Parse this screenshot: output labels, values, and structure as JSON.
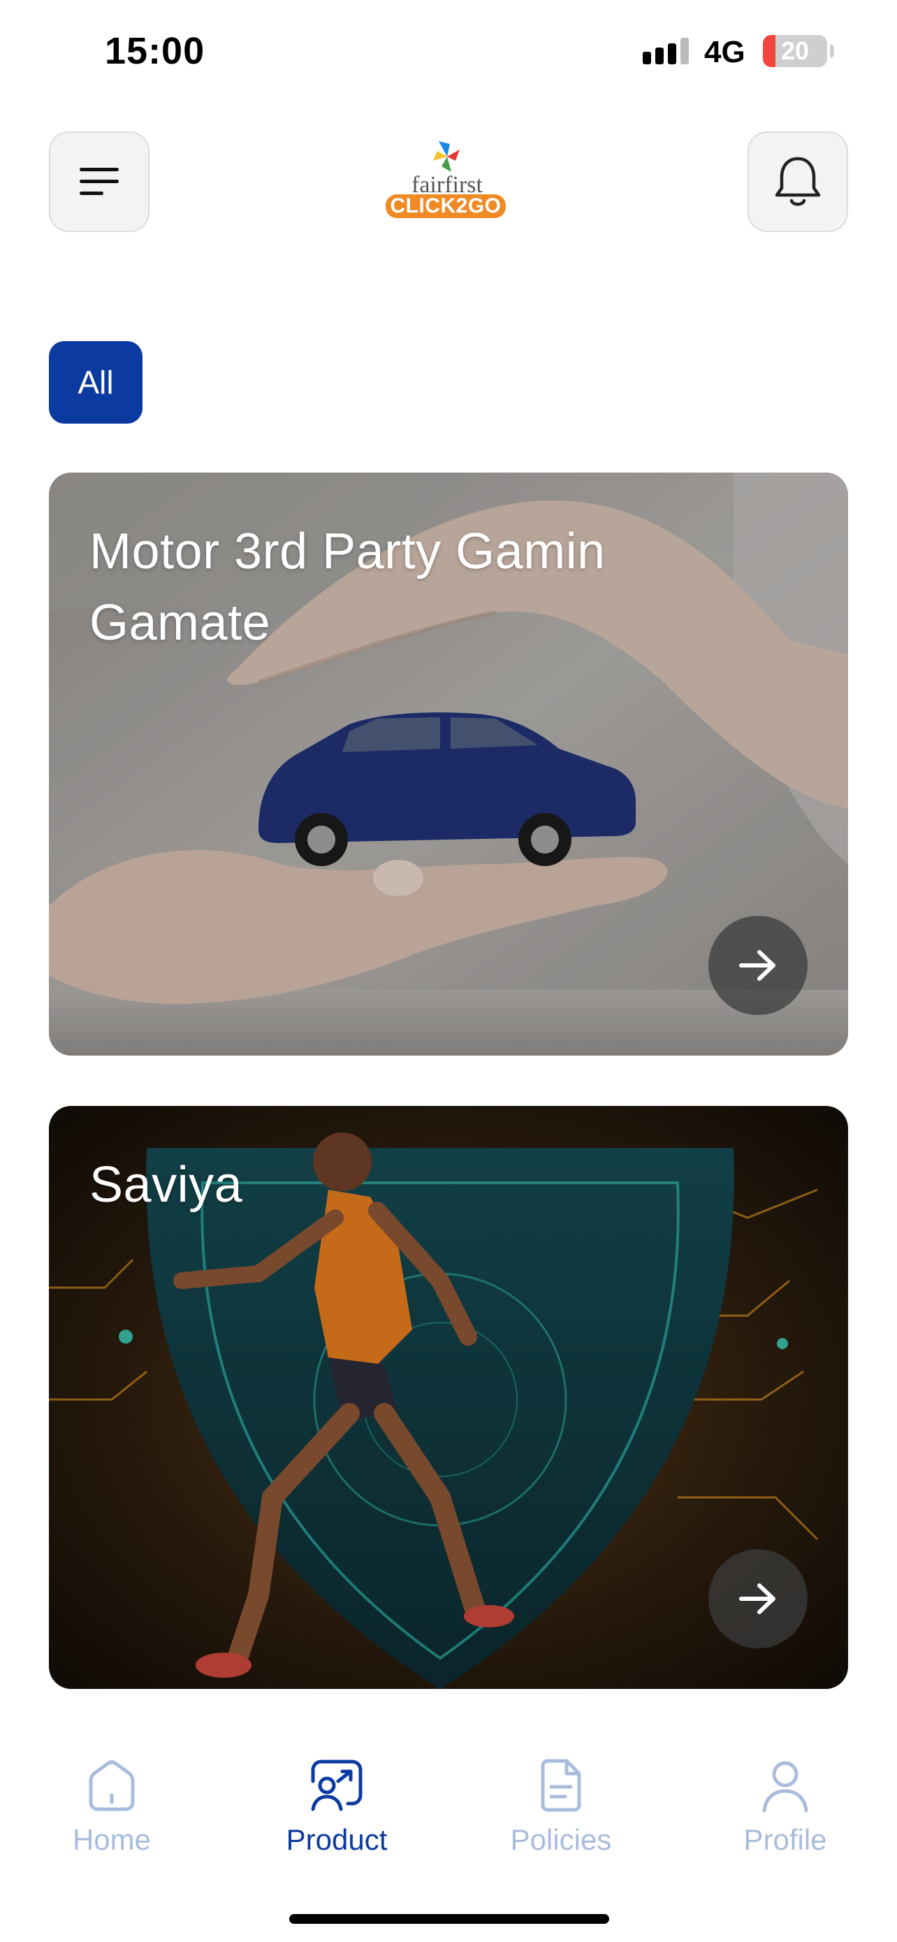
{
  "status_bar": {
    "time": "15:00",
    "network": "4G",
    "battery": "20",
    "battery_level": 0.2
  },
  "header": {
    "menu_icon": "menu-icon",
    "bell_icon": "bell-icon",
    "logo": {
      "top_text": "fairfirst",
      "bottom_text": "CLICK2GO"
    }
  },
  "filters": {
    "selected": "All"
  },
  "products": [
    {
      "title": "Motor 3rd Party Gamin Gamate",
      "arrow_icon": "arrow-right-icon"
    },
    {
      "title": "Saviya",
      "arrow_icon": "arrow-right-icon"
    }
  ],
  "bottom_nav": {
    "items": [
      {
        "label": "Home",
        "icon": "home-icon",
        "active": false
      },
      {
        "label": "Product",
        "icon": "product-icon",
        "active": true
      },
      {
        "label": "Policies",
        "icon": "policies-icon",
        "active": false
      },
      {
        "label": "Profile",
        "icon": "profile-icon",
        "active": false
      }
    ]
  },
  "colors": {
    "primary": "#0b3aa0",
    "nav_inactive": "#a9bcdc",
    "logo_orange": "#f08a24",
    "battery_red": "#f2453d"
  }
}
